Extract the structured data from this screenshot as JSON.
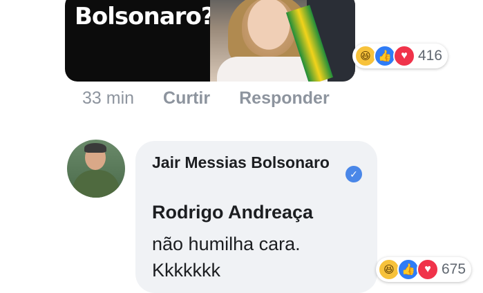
{
  "top_comment": {
    "meme_text": "Bolsonaro?",
    "reactions": {
      "icons": [
        "haha-icon",
        "like-icon",
        "love-icon"
      ],
      "count": "416"
    },
    "actions": {
      "time": "33 min",
      "like_label": "Curtir",
      "reply_label": "Responder"
    }
  },
  "reply_comment": {
    "author": "Jair Messias Bolsonaro",
    "verified": true,
    "mention": "Rodrigo Andreaça",
    "text": "não humilha cara. Kkkkkkk",
    "reactions": {
      "icons": [
        "haha-icon",
        "like-icon",
        "love-icon"
      ],
      "count": "675"
    }
  },
  "colors": {
    "like": "#2f7cf6",
    "love": "#f0334a",
    "haha": "#f7c23b",
    "verified": "#4a87e8",
    "bubble": "#f0f2f5"
  }
}
